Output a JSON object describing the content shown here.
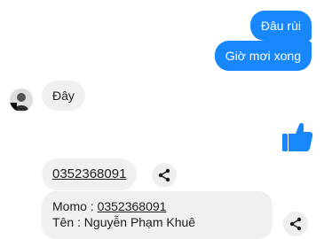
{
  "messages": {
    "outgoing_1": "Đâu rùi",
    "outgoing_2": "Giờ mơi xong",
    "incoming_1": "Đây",
    "phone_number": "0352368091",
    "momo_label": "Momo : ",
    "momo_number": "0352368091",
    "name_line": "Tên : Nguyễn Phạm Khuê"
  },
  "colors": {
    "outgoing_bubble": "#1787fb",
    "incoming_bubble": "#f0f0f0",
    "like": "#1787fb"
  },
  "icons": {
    "like": "thumbs-up-icon",
    "share": "share-icon",
    "avatar": "user-avatar"
  }
}
